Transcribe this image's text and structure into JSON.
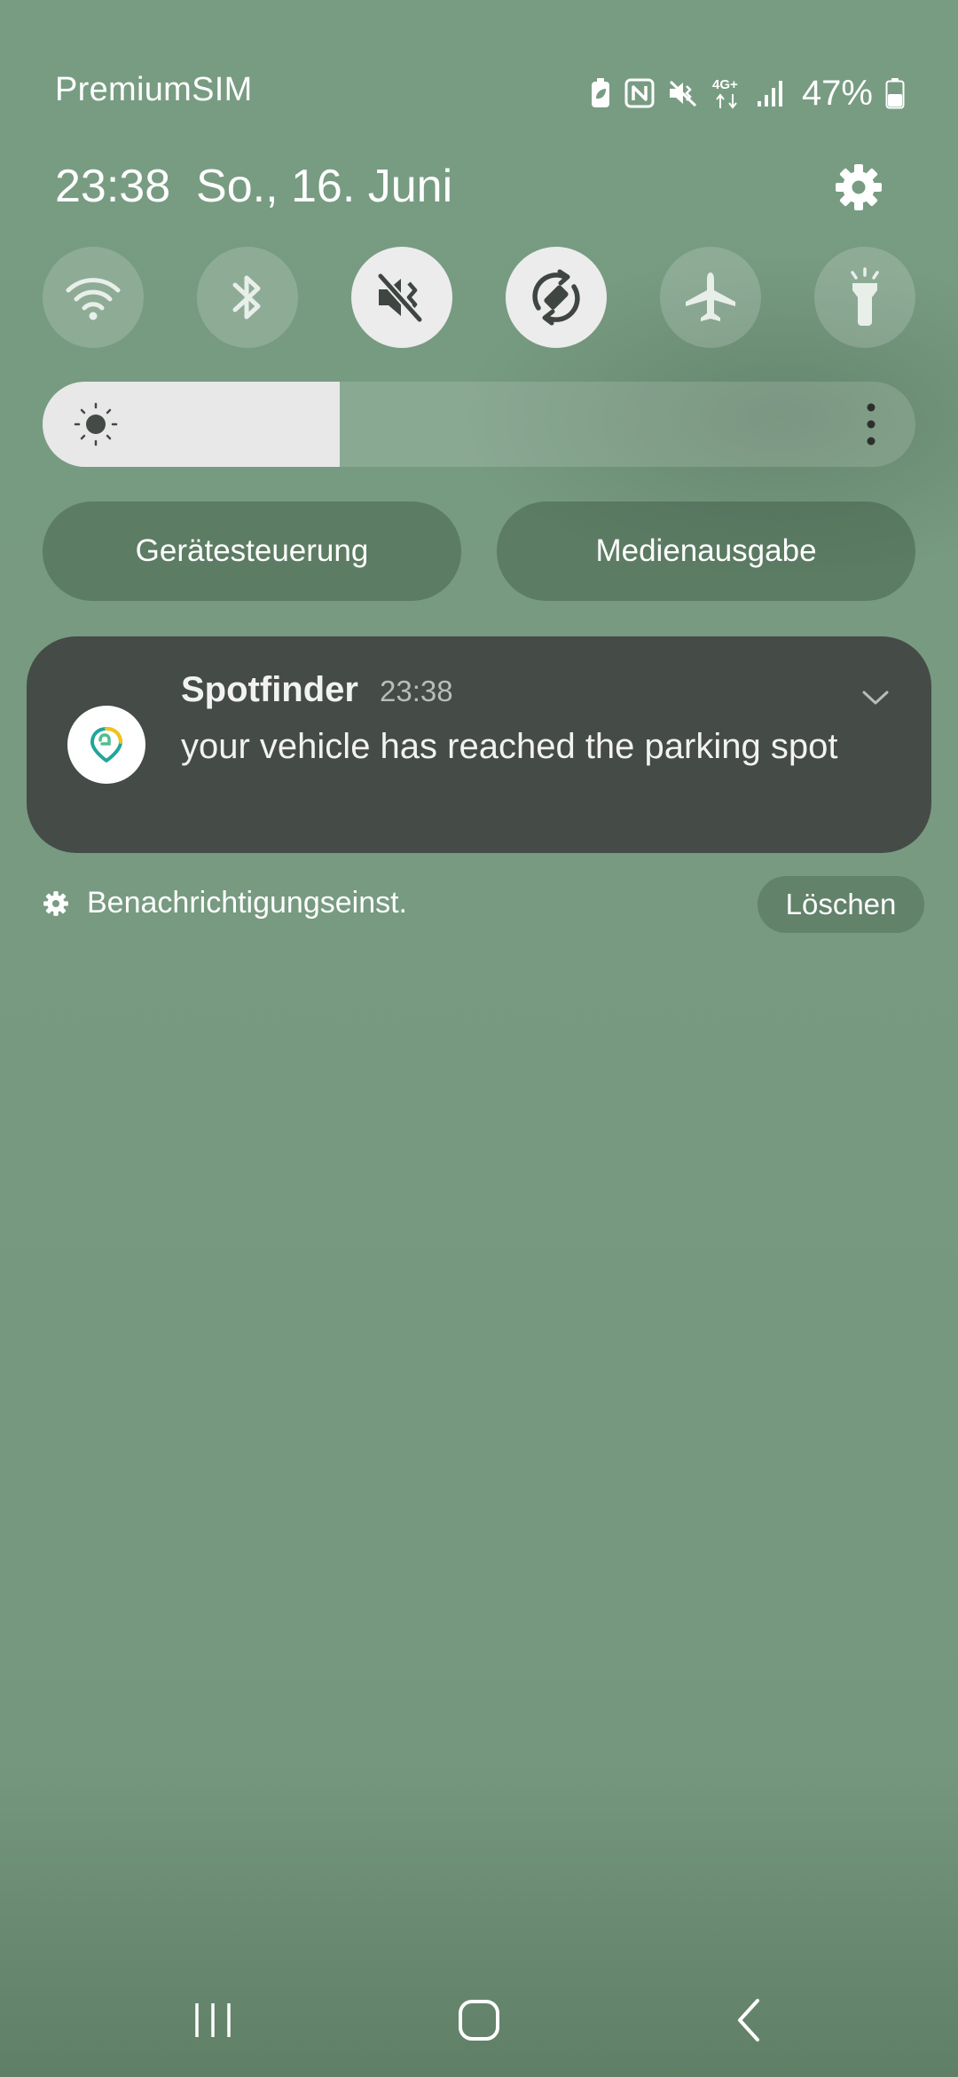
{
  "status_bar": {
    "carrier": "PremiumSIM",
    "network": "4G+",
    "battery_percent": "47%",
    "icons": [
      "battery-saver-icon",
      "nfc-icon",
      "mute-icon",
      "network-4g-icon",
      "signal-icon",
      "battery-icon"
    ]
  },
  "header": {
    "time": "23:38",
    "date": "So., 16. Juni",
    "settings_icon": "gear-icon"
  },
  "quick_toggles": [
    {
      "name": "wifi",
      "icon": "wifi-icon",
      "active": false
    },
    {
      "name": "bluetooth",
      "icon": "bluetooth-icon",
      "active": false
    },
    {
      "name": "sound",
      "icon": "mute-icon",
      "active": true
    },
    {
      "name": "auto-rotate",
      "icon": "rotate-icon",
      "active": true
    },
    {
      "name": "airplane-mode",
      "icon": "airplane-icon",
      "active": false
    },
    {
      "name": "flashlight",
      "icon": "flashlight-icon",
      "active": false
    }
  ],
  "brightness": {
    "level": 0.34,
    "icon": "sun-icon",
    "more_icon": "more-vertical-icon"
  },
  "buttons": {
    "device_control": "Gerätesteuerung",
    "media_output": "Medienausgabe"
  },
  "notification": {
    "app_name": "Spotfinder",
    "time": "23:38",
    "message": "your vehicle has reached the parking spot",
    "icon": "spotfinder-app-icon",
    "expand_icon": "chevron-down-icon"
  },
  "notification_footer": {
    "settings_label": "Benachrichtigungseinst.",
    "clear_label": "Löschen"
  },
  "navigation": {
    "recents": "recents-icon",
    "home": "home-icon",
    "back": "back-icon"
  },
  "colors": {
    "background": "#779c82",
    "card": "#454b47",
    "active_toggle": "#ececec"
  }
}
